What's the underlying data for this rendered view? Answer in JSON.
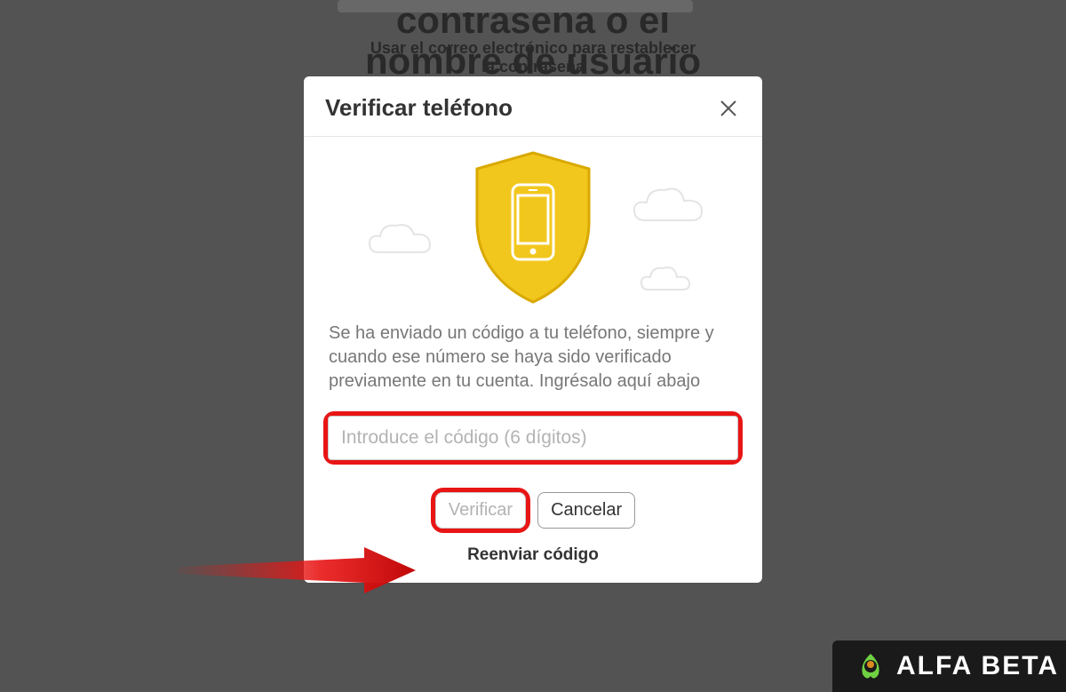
{
  "background": {
    "heading_line1": "contraseña o el",
    "heading_line2": "nombre de usuario",
    "email_reset_line1": "Usar el correo electrónico para restablecer",
    "email_reset_line2": "la contraseña"
  },
  "modal": {
    "title": "Verificar teléfono",
    "instruction": "Se ha enviado un código a tu teléfono, siempre y cuando ese número se haya sido verificado previamente en tu cuenta. Ingrésalo aquí abajo",
    "code_placeholder": "Introduce el código (6 dígitos)",
    "verify_label": "Verificar",
    "cancel_label": "Cancelar",
    "resend_label": "Reenviar código"
  },
  "watermark": {
    "text": "ALFA BETA"
  },
  "annotation": {
    "highlight_color": "#e81515"
  }
}
